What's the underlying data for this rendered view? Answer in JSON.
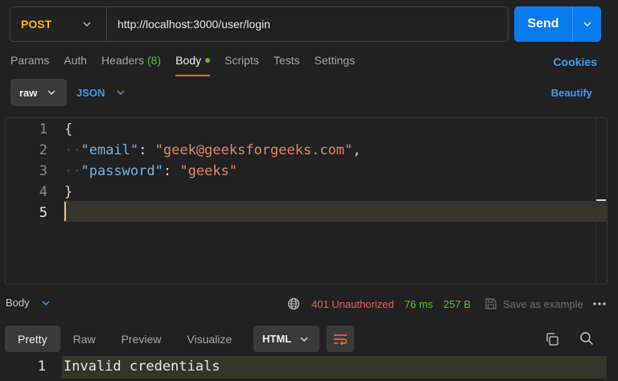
{
  "request": {
    "method": "POST",
    "url": "http://localhost:3000/user/login",
    "send_label": "Send"
  },
  "tabs": [
    {
      "label": "Params"
    },
    {
      "label": "Auth"
    },
    {
      "label": "Headers",
      "count": "(8)"
    },
    {
      "label": "Body",
      "active": true
    },
    {
      "label": "Scripts"
    },
    {
      "label": "Tests"
    },
    {
      "label": "Settings"
    }
  ],
  "cookies_label": "Cookies",
  "body_mode": "raw",
  "body_language": "JSON",
  "beautify_label": "Beautify",
  "editor": {
    "line_numbers": [
      "1",
      "2",
      "3",
      "4",
      "5"
    ],
    "lines": {
      "open": "{",
      "email_key": "\"email\"",
      "colon": ": ",
      "email_value": "\"geek@geeksforgeeks.com\"",
      "comma": ",",
      "password_key": "\"password\"",
      "password_value": "\"geeks\"",
      "close": "}"
    }
  },
  "response": {
    "section_label": "Body",
    "status": "401 Unauthorized",
    "time": "76 ms",
    "size": "257 B",
    "save_label": "Save as example",
    "tabs": [
      "Pretty",
      "Raw",
      "Preview",
      "Visualize"
    ],
    "format": "HTML",
    "line_number": "1",
    "text": "Invalid credentials"
  },
  "colors": {
    "send": "#097bed",
    "method": "#ffb400",
    "accent_tab": "#ff6c37",
    "link": "#3d9bf5",
    "error": "#ef5b4f",
    "ok": "#52c41a"
  },
  "icons": [
    "chevron-down-icon",
    "globe-icon",
    "save-icon",
    "more-icon",
    "wrap-icon",
    "copy-icon",
    "search-icon"
  ]
}
